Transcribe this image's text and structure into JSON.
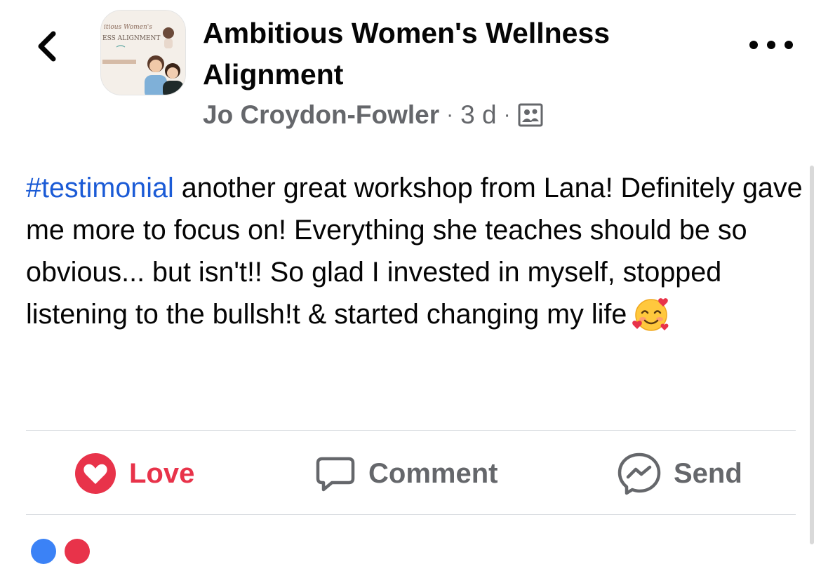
{
  "header": {
    "group_name": "Ambitious Women's Wellness Alignment",
    "avatar_caption_line1": "itious Women's",
    "avatar_caption_line2": "ESS ALIGNMENT"
  },
  "post_meta": {
    "author": "Jo Croydon-Fowler",
    "separator": "·",
    "time": "3 d",
    "audience_icon": "group-members-icon"
  },
  "post": {
    "hashtag": "#testimonial",
    "body": " another great workshop from Lana! Definitely gave me more to focus on! Everything she teaches should be so obvious... but isn't!! So glad I invested in myself, stopped listening to the bullsh!t & started changing my life",
    "emoji": "smiling-face-with-hearts"
  },
  "actions": {
    "love_label": "Love",
    "comment_label": "Comment",
    "send_label": "Send"
  },
  "colors": {
    "love": "#e8334a",
    "hashtag": "#1b5bd6",
    "secondary_text": "#65676b",
    "primary_text": "#050505",
    "divider": "#dadde1"
  },
  "icons": {
    "back": "chevron-left-icon",
    "more": "more-options-icon",
    "love": "heart-icon",
    "comment": "comment-bubble-icon",
    "send": "messenger-icon"
  }
}
